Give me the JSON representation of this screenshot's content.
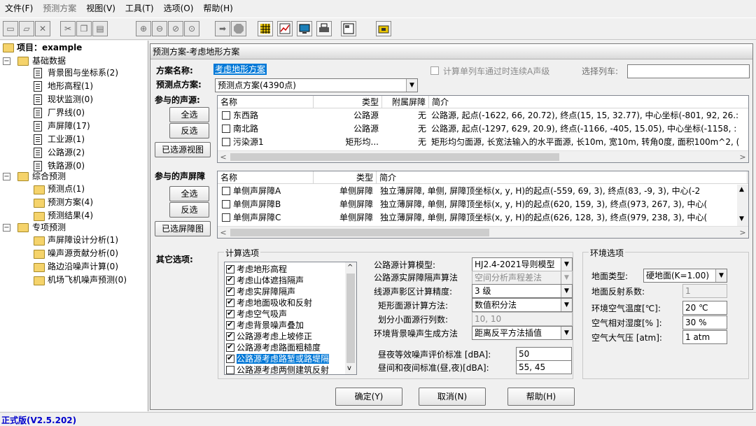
{
  "menu": [
    {
      "label": "文件(F)",
      "enabled": true
    },
    {
      "label": "预测方案",
      "enabled": false
    },
    {
      "label": "视图(V)",
      "enabled": true
    },
    {
      "label": "工具(T)",
      "enabled": true
    },
    {
      "label": "选项(O)",
      "enabled": true
    },
    {
      "label": "帮助(H)",
      "enabled": true
    }
  ],
  "toolbar_icons": [
    "new-icon",
    "open-icon",
    "close-icon",
    "cut-icon",
    "copy-icon",
    "paste-icon",
    "zoom-in-icon",
    "zoom-out-icon",
    "zoom-icon",
    "zoom-fit-icon",
    "arrow-right-icon",
    "stop-icon",
    "grid-icon",
    "chart-icon",
    "monitor-icon",
    "print-icon",
    "properties-icon",
    "folder-icon"
  ],
  "tree": {
    "root": "项目：example",
    "group1": {
      "label": "基础数据",
      "items": [
        "背景图与坐标系(2)",
        "地形高程(1)",
        "现状监测(0)",
        "厂界线(0)",
        "声屏障(17)",
        "工业源(1)",
        "公路源(2)",
        "铁路源(0)"
      ]
    },
    "group2": {
      "label": "综合预测",
      "items": [
        "预测点(1)",
        "预测方案(4)",
        "预测结果(4)"
      ]
    },
    "group3": {
      "label": "专项预测",
      "items": [
        "声屏障设计分析(1)",
        "噪声源贡献分析(0)",
        "路边沿噪声计算(0)",
        "机场飞机噪声预测(0)"
      ]
    }
  },
  "dialog": {
    "title": "预测方案-考虑地形方案",
    "scheme_name_label": "方案名称:",
    "scheme_name_value": "考虑地形方案",
    "continuous_train_label": "计算单列车通过时连续A声级",
    "select_train_label": "选择列车:",
    "point_scheme_label": "预测点方案:",
    "point_scheme_value": "预测点方案(4390点)",
    "sources_label": "参与的声源:",
    "btn_select_all": "全选",
    "btn_invert": "反选",
    "btn_view_sources": "已选源视图",
    "sources_columns": [
      "名称",
      "类型",
      "附属屏障",
      "简介"
    ],
    "sources_rows": [
      {
        "name": "东西路",
        "type": "公路源",
        "barrier": "无",
        "desc": "公路源, 起点(-1622, 66, 20.72), 终点(15, 15, 32.77), 中心坐标(-801, 92, 26.:"
      },
      {
        "name": "南北路",
        "type": "公路源",
        "barrier": "无",
        "desc": "公路源, 起点(-1297, 629, 20.9), 终点(-1166, -405, 15.05), 中心坐标(-1158, :"
      },
      {
        "name": "污染源1",
        "type": "矩形均...",
        "barrier": "无",
        "desc": "矩形均匀面源, 长宽法输入的水平面源, 长10m, 宽10m, 转角0度, 面积100m^2, ("
      }
    ],
    "barriers_label": "参与的声屏障",
    "btn_view_barriers": "已选屏障图",
    "barriers_columns": [
      "名称",
      "类型",
      "简介"
    ],
    "barriers_rows": [
      {
        "name": "单侧声屏障A",
        "type": "单侧屏障",
        "desc": "独立薄屏障, 单侧, 屏障顶坐标(x, y, H)的起点(-559, 69, 3), 终点(83, -9, 3), 中心(-2"
      },
      {
        "name": "单侧声屏障B",
        "type": "单侧屏障",
        "desc": "独立薄屏障, 单侧, 屏障顶坐标(x, y, H)的起点(620, 159, 3), 终点(973, 267, 3), 中心("
      },
      {
        "name": "单侧声屏障C",
        "type": "单侧屏障",
        "desc": "独立薄屏障, 单侧, 屏障顶坐标(x, y, H)的起点(626, 128, 3), 终点(979, 238, 3), 中心("
      }
    ],
    "other_options_label": "其它选项:",
    "calc_group_label": "计算选项",
    "calc_items": [
      "考虑地形高程",
      "考虑山体遮挡隔声",
      "考虑实屏障隔声",
      "考虑地面吸收和反射",
      "考虑空气吸声",
      "考虑背景噪声叠加",
      "公路源考虑上坡修正",
      "公路源考虑路面粗糙度",
      "公路源考虑路堑或路堤隔",
      "公路源考虑两侧建筑反射"
    ],
    "road_model_label": "公路源计算模型:",
    "road_model_value": "HJ2.4-2021导则模型",
    "road_barrier_algo_label": "公路源实屏障隔声算法",
    "road_barrier_algo_value": "空间分析声程差法",
    "line_precision_label": "线源声影区计算精度:",
    "line_precision_value": "3 级",
    "rect_method_label": "矩形面源计算方法:",
    "rect_method_value": "数值积分法",
    "rect_grid_label": "划分小面源行列数:",
    "rect_grid_value": "10, 10",
    "bg_noise_label": "环境背景噪声生成方法",
    "bg_noise_value": "距离反平方法插值",
    "day_night_label": "昼夜等效噪声评价标准 [dBA]:",
    "day_night_value": "50",
    "day_night2_label": "昼间和夜间标准(昼,夜)[dBA]:",
    "day_night2_value": "55, 45",
    "env_group_label": "环境选项",
    "ground_type_label": "地面类型:",
    "ground_type_value": "硬地面(K=1.00)",
    "ground_reflect_label": "地面反射系数:",
    "ground_reflect_value": "1",
    "air_temp_label": "环境空气温度[℃]:",
    "air_temp_value": "20 ℃",
    "humidity_label": "空气相对湿度[% ]:",
    "humidity_value": "30 %",
    "pressure_label": "空气大气压 [atm]:",
    "pressure_value": "1 atm",
    "btn_ok": "确定(Y)",
    "btn_cancel": "取消(N)",
    "btn_help": "帮助(H)"
  },
  "status": "正式版(V2.5.202)",
  "colors": {
    "selection": "#0078d7",
    "status_text": "#0000cc",
    "folder": "#f5d36b"
  }
}
